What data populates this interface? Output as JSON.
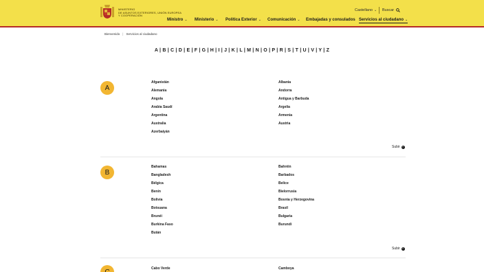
{
  "header": {
    "ministry_line1": "MINISTERIO",
    "ministry_line2": "DE ASUNTOS EXTERIORES, UNIÓN EUROPEA",
    "ministry_line3": "Y COOPERACIÓN",
    "language": "Castellano",
    "search_label": "Buscar",
    "colors": {
      "background": "#f3e04a",
      "accent_line": "#b52b27"
    }
  },
  "nav": {
    "items": [
      {
        "label": "Ministro",
        "has_dropdown": true
      },
      {
        "label": "Ministerio",
        "has_dropdown": true
      },
      {
        "label": "Política Exterior",
        "has_dropdown": true
      },
      {
        "label": "Comunicación",
        "has_dropdown": true
      },
      {
        "label": "Embajadas y consulados",
        "has_dropdown": false
      },
      {
        "label": "Servicios al ciudadano",
        "has_dropdown": true,
        "active": true
      }
    ]
  },
  "breadcrumb": {
    "items": [
      "Bienvenido",
      "Servicios al ciudadano"
    ]
  },
  "alphabet": "A | B | C | D | E | F | G | H | I | J | K | L | M | N | O | P | R | S | T | U | V | Y | Z",
  "sections": [
    {
      "letter": "A",
      "left": [
        "Afganistán",
        "Alemania",
        "Angola",
        "Arabia Saudí",
        "Argentina",
        "Australia",
        "Azerbaiyán"
      ],
      "right": [
        "Albania",
        "Andorra",
        "Antigua y Barbuda",
        "Argelia",
        "Armenia",
        "Austria"
      ],
      "up_label": "Subir"
    },
    {
      "letter": "B",
      "left": [
        "Bahamas",
        "Bangladesh",
        "Bélgica",
        "Benín",
        "Bolivia",
        "Botsuana",
        "Brunéi",
        "Burkina Faso",
        "Bután"
      ],
      "right": [
        "Bahréin",
        "Barbados",
        "Belice",
        "Bielorrusia",
        "Bosnia y Herzegovina",
        "Brasil",
        "Bulgaria",
        "Burundi"
      ],
      "up_label": "Subir"
    },
    {
      "letter": "C",
      "left": [
        "Cabo Verde"
      ],
      "right": [
        "Camboya"
      ],
      "up_label": ""
    }
  ],
  "colors": {
    "letter_circle": "#f2b632"
  }
}
